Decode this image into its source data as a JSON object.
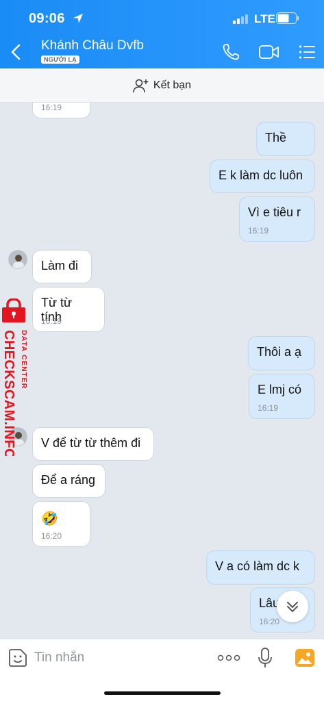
{
  "status_bar": {
    "time": "09:06",
    "network": "LTE"
  },
  "header": {
    "contact_name": "Khánh Châu Dvfb",
    "badge": "NGƯỜI LẠ"
  },
  "add_friend": {
    "label": "Kết bạn"
  },
  "messages": [
    {
      "dir": "in",
      "text": "",
      "time": "16:19"
    },
    {
      "dir": "out",
      "text": "Thề",
      "time": ""
    },
    {
      "dir": "out",
      "text": "E k làm dc luôn",
      "time": ""
    },
    {
      "dir": "out",
      "text": "Vì e tiêu r",
      "time": "16:19"
    },
    {
      "dir": "in",
      "text": "Làm đi",
      "time": ""
    },
    {
      "dir": "in",
      "text": "Từ từ tính",
      "time": "16:19"
    },
    {
      "dir": "out",
      "text": "Thôi a ạ",
      "time": ""
    },
    {
      "dir": "out",
      "text": "E lmj có",
      "time": "16:19"
    },
    {
      "dir": "in",
      "text": "V để từ từ thêm đi",
      "time": ""
    },
    {
      "dir": "in",
      "text": "Để a ráng",
      "time": ""
    },
    {
      "dir": "in",
      "text": "🤣",
      "time": "16:20"
    },
    {
      "dir": "out",
      "text": "V a có làm dc k",
      "time": ""
    },
    {
      "dir": "out",
      "text": "Lâu",
      "time": "16:20"
    }
  ],
  "watermark": {
    "line1": "DATA CENTER",
    "line2": "CHECKSCAM.INFO"
  },
  "composer": {
    "placeholder": "Tin nhắn",
    "value": ""
  }
}
